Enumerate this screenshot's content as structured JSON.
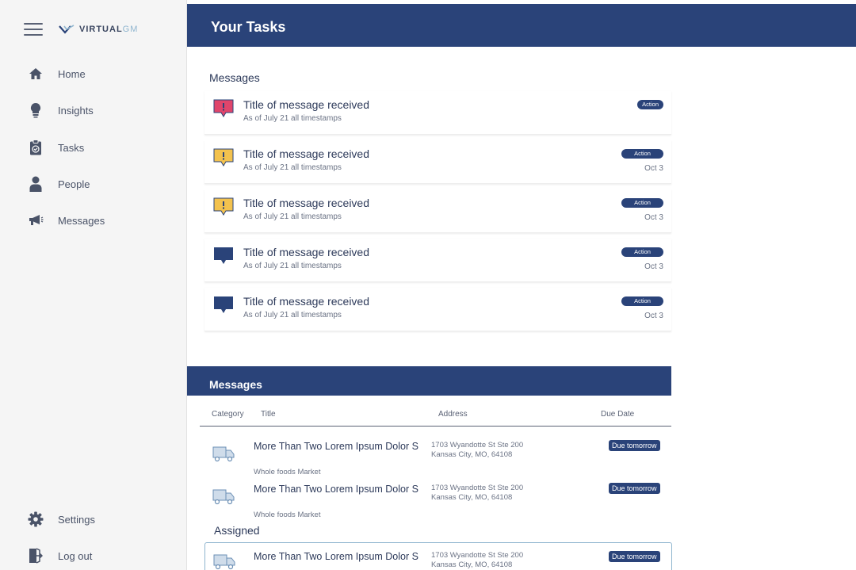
{
  "sidebar": {
    "logo": {
      "brand": "VIRTUAL",
      "suffix": "GM"
    },
    "items": [
      {
        "label": "Home",
        "icon": "home-icon"
      },
      {
        "label": "Insights",
        "icon": "lightbulb-icon"
      },
      {
        "label": "Tasks",
        "icon": "clipboard-icon"
      },
      {
        "label": "People",
        "icon": "person-icon"
      },
      {
        "label": "Messages",
        "icon": "megaphone-icon"
      }
    ],
    "bottom": [
      {
        "label": "Settings",
        "icon": "gear-icon"
      },
      {
        "label": "Log out",
        "icon": "logout-icon"
      }
    ]
  },
  "header": {
    "title": "Your Tasks"
  },
  "messages": {
    "title": "Messages",
    "items": [
      {
        "title": "Title of message received",
        "subtitle": "As of July 21 all timestamps",
        "badge": "Action",
        "date": "",
        "kind": "urgent",
        "color": "#e0456b"
      },
      {
        "title": "Title of message received",
        "subtitle": "As of July 21 all timestamps",
        "badge": "Action",
        "date": "Oct 3",
        "kind": "warning",
        "color": "#f3c24e"
      },
      {
        "title": "Title of message received",
        "subtitle": "As of July 21 all timestamps",
        "badge": "Action",
        "date": "Oct 3",
        "kind": "warning",
        "color": "#f3c24e"
      },
      {
        "title": "Title of message received",
        "subtitle": "As of July 21 all timestamps",
        "badge": "Action",
        "date": "Oct 3",
        "kind": "info",
        "color": "#2a4379"
      },
      {
        "title": "Title of message received",
        "subtitle": "As of July 21 all timestamps",
        "badge": "Action",
        "date": "Oct 3",
        "kind": "info",
        "color": "#2a4379"
      }
    ]
  },
  "tasks_panel": {
    "title": "Messages",
    "columns": {
      "category": "Category",
      "title": "Title",
      "address": "Address",
      "due": "Due Date"
    },
    "rows": [
      {
        "title": "More Than Two Lorem Ipsum Dolor S",
        "store": "Whole foods Market",
        "address_line1": "1703 Wyandotte St Ste 200",
        "address_line2": "Kansas City, MO, 64108",
        "due": "Due tomorrow",
        "icon": "truck-icon"
      },
      {
        "title": "More Than Two Lorem Ipsum Dolor S",
        "store": "Whole foods Market",
        "address_line1": "1703 Wyandotte St Ste 200",
        "address_line2": "Kansas City, MO, 64108",
        "due": "Due tomorrow",
        "icon": "truck-icon"
      }
    ],
    "assigned": {
      "title": "Assigned",
      "rows": [
        {
          "title": "More Than Two Lorem Ipsum Dolor S",
          "address_line1": "1703 Wyandotte St Ste 200",
          "address_line2": "Kansas City, MO, 64108",
          "due": "Due tomorrow",
          "icon": "truck-icon"
        }
      ]
    }
  },
  "colors": {
    "primary": "#2a4379",
    "urgent": "#e0456b",
    "warning": "#f3c24e",
    "sidebar_bg": "#f5f5f5"
  }
}
